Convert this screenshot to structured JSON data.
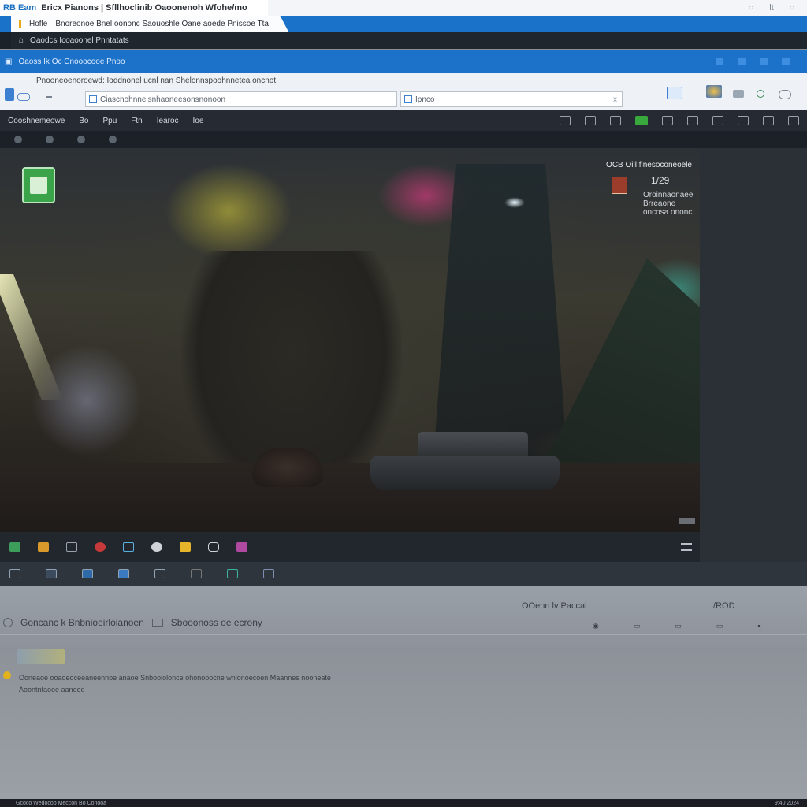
{
  "app": {
    "logo": "RB Eam",
    "title": "Ericx Pianons | Sfllhoclinib Oaoonenoh Wfohe/mo",
    "window_controls": [
      "○",
      "lt",
      "○"
    ]
  },
  "tab2": {
    "label": "Hofle",
    "extra": "Bnoreonoe Bnel oononc Saouoshle Oane aoede  Pnissoe Tta"
  },
  "darkbar": {
    "text": "Oaodcs  Icoaoonel Pnntatats"
  },
  "bluestrip": {
    "text": "Oaoss Ik Oc Cnooocooe Pnoo"
  },
  "address": {
    "description": "Pnooneoenoroewd: Ioddnonel ucnl nan Shelonnspoohnnetea oncnot.",
    "field1": "Ciascnohnneisnhaoneesonsnonoon",
    "field2": "Ipnco",
    "close": "x"
  },
  "toolbar": {
    "label": "Cooshnemeowe",
    "items": [
      "Bo",
      "Ppu",
      "Ftn",
      "Iearoc",
      "Ioe"
    ]
  },
  "overlay": {
    "title": "OCB Oill finesoconeoele",
    "nums": "1/29",
    "text_line1": "Oroinnaonaee",
    "text_line2": "Brreaone",
    "text_line3": "oncosa ononc"
  },
  "lower": {
    "line1": "OOenn lv Paccal",
    "zoom": "I/ROD",
    "row2_label": "Goncanc k Bnbnioeirloianoen",
    "row2_search": "Sbooonoss oe ecrony",
    "message_line1": "Ooneaoe ooaoeoceeaneennoe anaoe Snbooiolonce ohonooocne wnlonoecoen Maannes nooneate",
    "message_line2": "Aoontnfaooe aaneed"
  },
  "taskbar": {
    "left": "Gcoco   Wedocob  Meccon  Bo  Conooa",
    "right": "9:40 2024"
  },
  "colors": {
    "accent_blue": "#1a73c9",
    "toolbar_dark": "#262b33",
    "badge_green": "#3ba34a"
  }
}
